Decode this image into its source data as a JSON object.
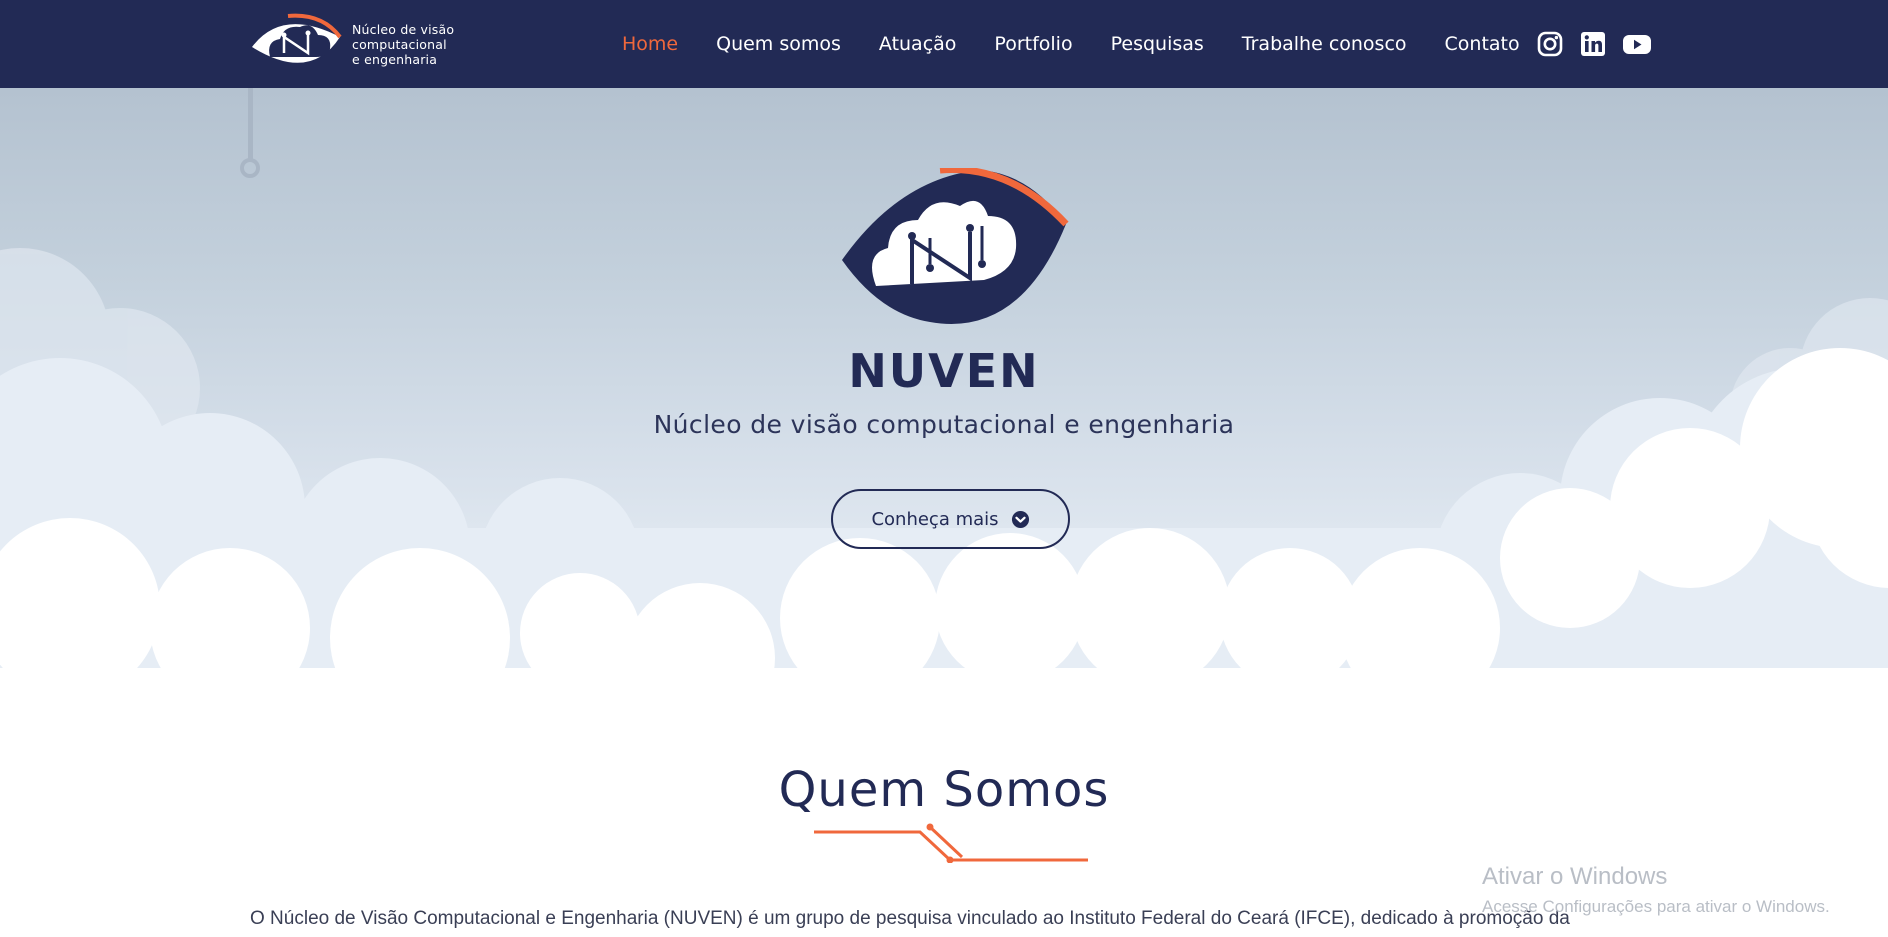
{
  "navbar": {
    "logo_text_lines": [
      "Núcleo de visão",
      "computacional",
      "e engenharia"
    ],
    "links": [
      {
        "label": "Home",
        "active": true
      },
      {
        "label": "Quem somos",
        "active": false
      },
      {
        "label": "Atuação",
        "active": false
      },
      {
        "label": "Portfolio",
        "active": false
      },
      {
        "label": "Pesquisas",
        "active": false
      },
      {
        "label": "Trabalhe conosco",
        "active": false
      },
      {
        "label": "Contato",
        "active": false
      }
    ],
    "social_icons": [
      "instagram-icon",
      "linkedin-icon",
      "youtube-icon"
    ]
  },
  "hero": {
    "title": "NUVEN",
    "subtitle": "Núcleo de visão computacional e engenharia",
    "button_label": "Conheça mais",
    "button_icon": "chevron-down-circle-icon"
  },
  "about": {
    "title": "Quem Somos",
    "text": "O Núcleo de Visão Computacional e Engenharia (NUVEN) é um grupo de pesquisa vinculado ao Instituto Federal do Ceará (IFCE), dedicado à promoção da"
  },
  "watermark": {
    "title": "Ativar o Windows",
    "subtitle": "Acesse Configurações para ativar o Windows."
  },
  "colors": {
    "navy": "#222a55",
    "accent_orange": "#f0683c",
    "hero_sky_top": "#b4c2d0",
    "cloud_white": "#ffffff"
  }
}
